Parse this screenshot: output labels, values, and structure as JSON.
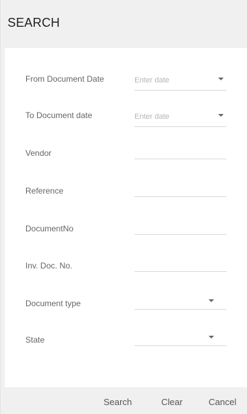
{
  "dialog": {
    "title": "SEARCH"
  },
  "form": {
    "from_date": {
      "label": "From Document Date",
      "placeholder": "Enter date",
      "value": ""
    },
    "to_date": {
      "label": "To Document date",
      "placeholder": "Enter date",
      "value": ""
    },
    "vendor": {
      "label": "Vendor",
      "value": ""
    },
    "reference": {
      "label": "Reference",
      "value": ""
    },
    "document_no": {
      "label": "DocumentNo",
      "value": ""
    },
    "inv_doc_no": {
      "label": "Inv. Doc. No.",
      "value": ""
    },
    "document_type": {
      "label": "Document type",
      "selected": ""
    },
    "state": {
      "label": "State",
      "selected": ""
    }
  },
  "footer": {
    "search_label": "Search",
    "clear_label": "Clear",
    "cancel_label": "Cancel"
  },
  "icons": {
    "dropdown": "chevron-down-icon"
  }
}
